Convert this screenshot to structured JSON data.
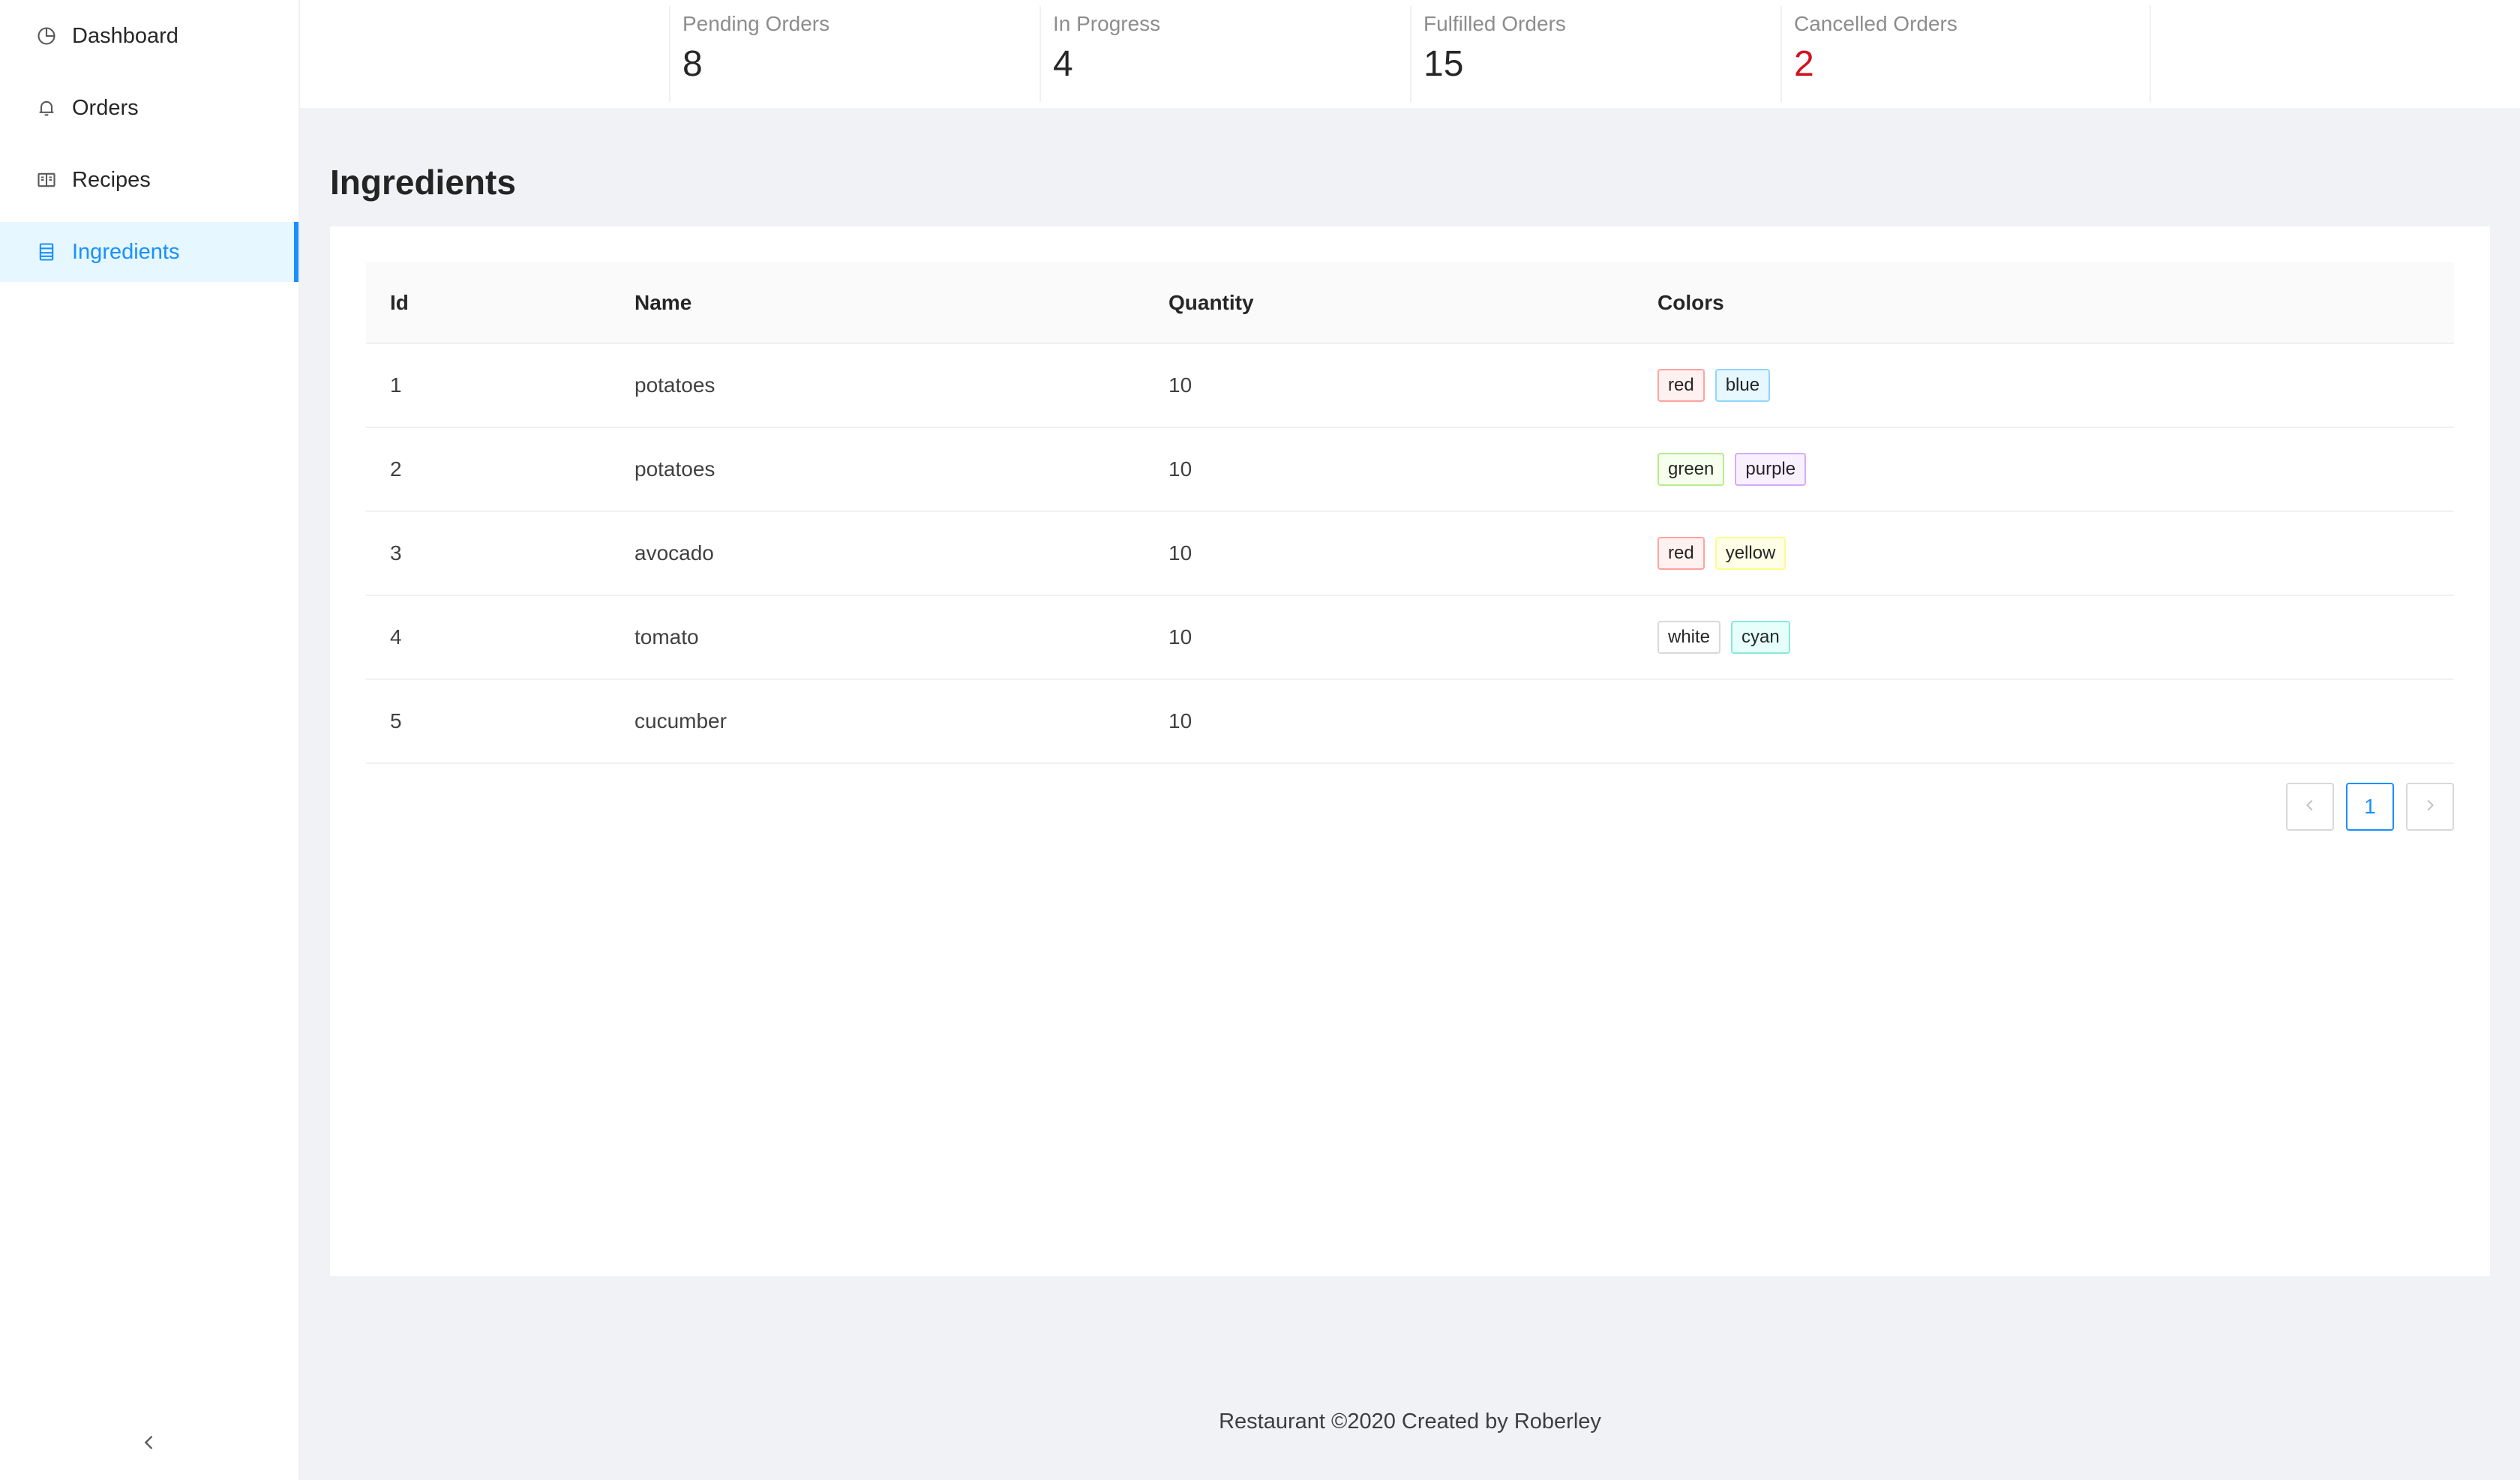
{
  "sidebar": {
    "items": [
      {
        "label": "Dashboard",
        "icon": "pie-chart-icon"
      },
      {
        "label": "Orders",
        "icon": "bell-icon"
      },
      {
        "label": "Recipes",
        "icon": "book-icon"
      },
      {
        "label": "Ingredients",
        "icon": "list-icon"
      }
    ],
    "active": "Ingredients",
    "collapse_icon": "chevron-left-icon"
  },
  "stats": [
    {
      "title": "Pending Orders",
      "value": "8"
    },
    {
      "title": "In Progress",
      "value": "4"
    },
    {
      "title": "Fulfilled Orders",
      "value": "15"
    },
    {
      "title": "Cancelled Orders",
      "value": "2",
      "color": "#cf1322"
    }
  ],
  "page": {
    "title": "Ingredients"
  },
  "table": {
    "columns": [
      "Id",
      "Name",
      "Quantity",
      "Colors"
    ],
    "rows": [
      {
        "id": "1",
        "name": "potatoes",
        "quantity": "10",
        "colors": [
          "red",
          "blue"
        ]
      },
      {
        "id": "2",
        "name": "potatoes",
        "quantity": "10",
        "colors": [
          "green",
          "purple"
        ]
      },
      {
        "id": "3",
        "name": "avocado",
        "quantity": "10",
        "colors": [
          "red",
          "yellow"
        ]
      },
      {
        "id": "4",
        "name": "tomato",
        "quantity": "10",
        "colors": [
          "white",
          "cyan"
        ]
      },
      {
        "id": "5",
        "name": "cucumber",
        "quantity": "10",
        "colors": []
      }
    ]
  },
  "tag_styles": {
    "red": {
      "bg": "#fff1f0",
      "border": "#ffa39e"
    },
    "blue": {
      "bg": "#e6f7ff",
      "border": "#91d5ff"
    },
    "green": {
      "bg": "#f6ffed",
      "border": "#b7eb8f"
    },
    "purple": {
      "bg": "#f9f0ff",
      "border": "#d3adf7"
    },
    "yellow": {
      "bg": "#feffe6",
      "border": "#fffb8f"
    },
    "white": {
      "bg": "#ffffff",
      "border": "#d9d9d9"
    },
    "cyan": {
      "bg": "#e6fffb",
      "border": "#87e8de"
    }
  },
  "pagination": {
    "current": "1",
    "prev_icon": "chevron-left-icon",
    "next_icon": "chevron-right-icon"
  },
  "footer": {
    "text": "Restaurant ©2020 Created by Roberley"
  }
}
